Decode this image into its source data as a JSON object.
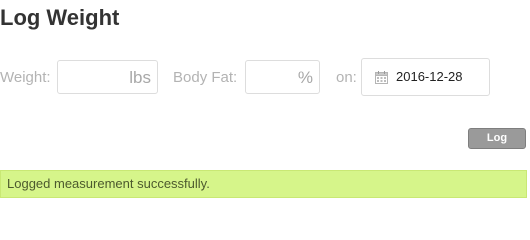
{
  "page": {
    "title": "Log Weight"
  },
  "form": {
    "weight_label": "Weight:",
    "weight_value": "",
    "weight_unit": "lbs",
    "bodyfat_label": "Body Fat:",
    "bodyfat_value": "",
    "bodyfat_unit": "%",
    "date_label": "on:",
    "date_value": "2016-12-28",
    "date_icon": "calendar-icon",
    "submit_label": "Log"
  },
  "alert": {
    "message": "Logged measurement successfully."
  },
  "colors": {
    "button_bg": "#9a9a9a",
    "success_bg": "#d6f58a",
    "label_gray": "#b3b3b3"
  }
}
